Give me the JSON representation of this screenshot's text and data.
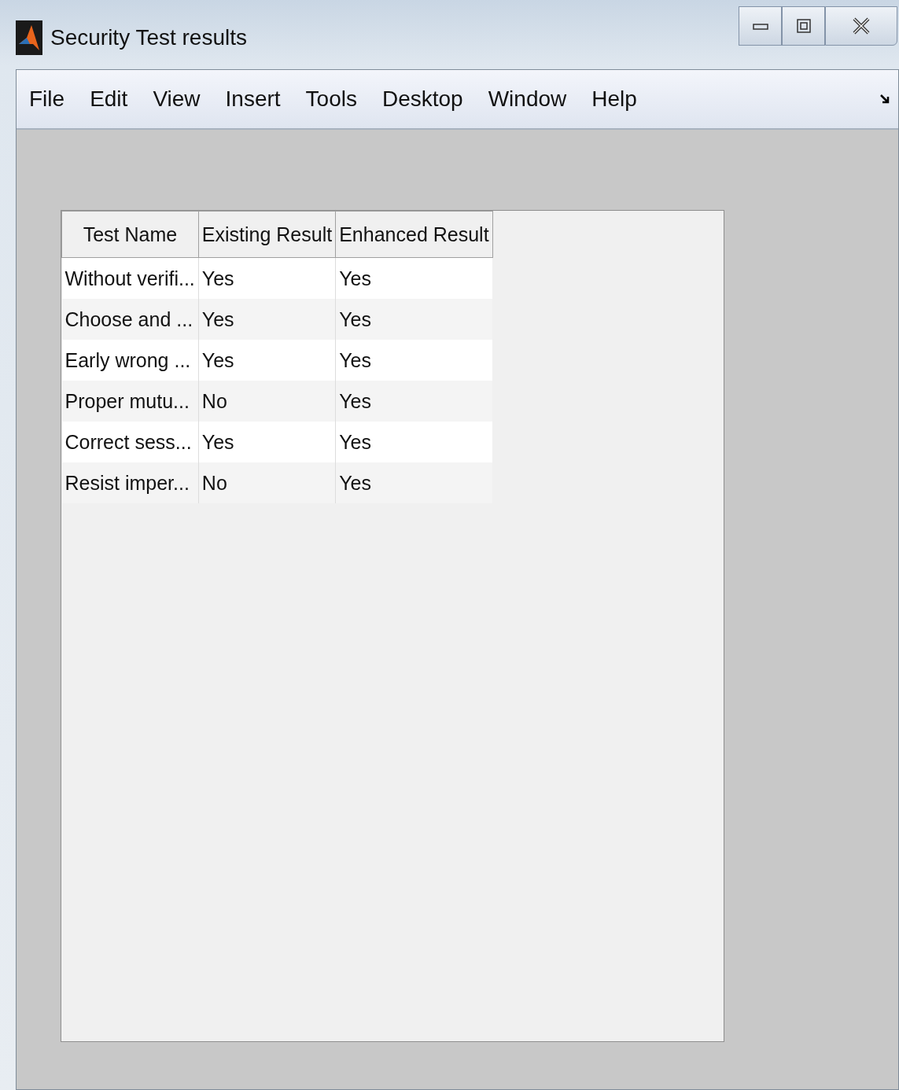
{
  "window": {
    "title": "Security Test results"
  },
  "menu": [
    "File",
    "Edit",
    "View",
    "Insert",
    "Tools",
    "Desktop",
    "Window",
    "Help"
  ],
  "table": {
    "columns": [
      "Test Name",
      "Existing Result",
      "Enhanced Result"
    ],
    "rows": [
      [
        "Without verifi...",
        "Yes",
        "Yes"
      ],
      [
        "Choose and ...",
        "Yes",
        "Yes"
      ],
      [
        "Early wrong ...",
        "Yes",
        "Yes"
      ],
      [
        "Proper mutu...",
        "No",
        "Yes"
      ],
      [
        "Correct sess...",
        "Yes",
        "Yes"
      ],
      [
        "Resist imper...",
        "No",
        "Yes"
      ]
    ]
  }
}
